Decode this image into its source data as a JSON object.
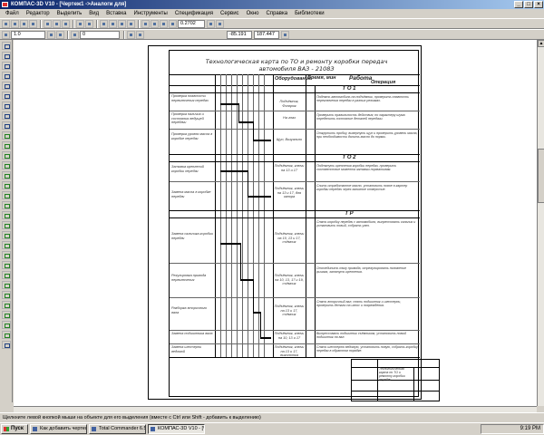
{
  "window": {
    "title": "КОМПАС-3D V10 - [Чертеж1 ->Аналоги для]",
    "buttons": [
      "_",
      "□",
      "×"
    ]
  },
  "menu": [
    "Файл",
    "Редактор",
    "Выделить",
    "Вид",
    "Вставка",
    "Инструменты",
    "Спецификация",
    "Сервис",
    "Окно",
    "Справка",
    "Библиотеки"
  ],
  "toolbar": {
    "zoom": "0.2702",
    "scale": "1.0",
    "style": "0",
    "coord_x": "-85.191",
    "coord_y": "187.447"
  },
  "drawing": {
    "title": "Технологическая карта по ТО и ремонту коробки передач автомобиля ВАЗ - 2108З",
    "headers": {
      "equipment": "Оборудование",
      "time": "Время, мин",
      "work": "Работа",
      "operation": "Операция"
    },
    "sections": [
      "Т О 1",
      "Т О 2",
      "Т Р"
    ],
    "operations": [
      "Проверка плавности переключения передач",
      "Проверка наличия и состояния ведущей передачи",
      "Проверка уровня масла в коробке передач",
      "Затяжка креплений коробки передач",
      "Замена масла в коробке передач",
      "Замена сальника коробки передач",
      "Регулировка привода переключения",
      "Разборка вторичного вала",
      "Замена подшипника вала",
      "Замена шестерни ведомой"
    ],
    "tools": [
      "Подъёмник, Фонарик",
      "На глаз",
      "Щуп, Визуально",
      "Подъёмник, ключи на 13 и 17",
      "Подъёмник, ключи на 13 и 17, для запора",
      "Подъёмник, ключи на 10, 13 и 17, съёмник",
      "Подъёмник, ключи на 10, 13, 17 и 19, съёмник",
      "Подъёмник, ключи на 13 и 17, съёмник",
      "Подъёмник, ключи на 10, 13 и 17",
      "Подъёмник, ключи на 13 и 17, выколотка"
    ],
    "descriptions": [
      "Поднять автомобиль на подъёмник, проверить плавность переключения передач в разных режимах.",
      "Проверить правильность действия; по характеру шума определить состояние деталей передачи.",
      "Открутить пробку, вывернуть щуп и проверить уровень масла, при необходимости долить масло до нормы.",
      "Подтянуть крепления коробки передач, проверить соответствие момента затяжки нормативам.",
      "Слить отработанное масло, установить новое в картер коробки передач через заливное отверстие.",
      "Снять коробку передач с автомобиля, выпрессовать сальник и установить новый, собрать узел.",
      "Отсоединить тягу привода, отрегулировать положение рычага, затянуть крепления.",
      "Снять вторичный вал, снять подшипник и шестерни, проверить детали на износ и повреждения.",
      "Выпрессовать подшипник съёмником, установить новый подшипник на вал.",
      "Снять шестерню ведомую, установить новую, собрать коробку передач в обратном порядке."
    ],
    "stamp_text": "Технологическая карта по ТО и ремонту коробки передач"
  },
  "status": "Щелкните левой кнопкой мыши на объекте для его выделения (вместе с Ctrl или Shift - добавить к выделению)",
  "taskbar": {
    "start": "Пуск",
    "tasks": [
      "Как добавить чертеж?...",
      "Total Commander 6.53 - ...",
      "КОМПАС-3D V10 - [Чер..."
    ],
    "time": "9:19 PM"
  }
}
